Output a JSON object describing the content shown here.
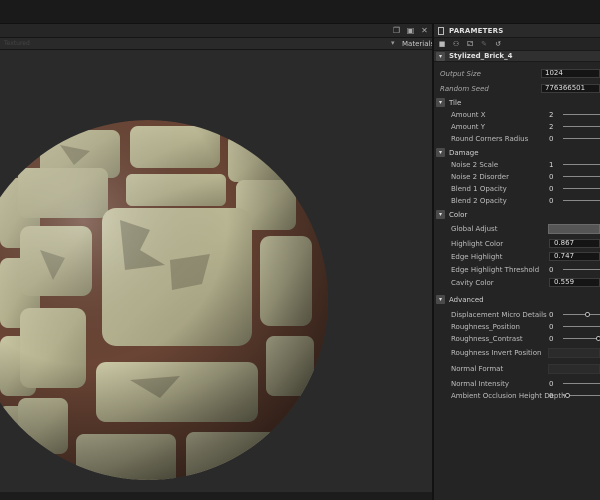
{
  "viewport": {
    "toolbar_ghost": "Textured",
    "materials_label": "Materials"
  },
  "panel": {
    "title": "PARAMETERS",
    "graph_name": "Stylized_Brick_4",
    "toggle_symbol": "▾",
    "collapse_symbol": "▾",
    "tools": [
      "lock-icon",
      "presets-icon",
      "random-icon",
      "pin-icon",
      "reset-icon"
    ],
    "output_size": {
      "label": "Output Size",
      "value": "1024"
    },
    "random_seed": {
      "label": "Random Seed",
      "value": "776366501"
    },
    "sections": {
      "tile": "Tile",
      "damage": "Damage",
      "color": "Color",
      "advanced": "Advanced"
    },
    "tile": [
      {
        "label": "Amount X",
        "value": "2",
        "level": 0.5
      },
      {
        "label": "Amount Y",
        "value": "2",
        "level": 0.5
      },
      {
        "label": "Round Corners Radius",
        "value": "0",
        "level": 0
      }
    ],
    "damage": [
      {
        "label": "Noise 2 Scale",
        "value": "1",
        "level": 0.5
      },
      {
        "label": "Noise 2 Disorder",
        "value": "0",
        "level": 0
      },
      {
        "label": "Blend 1 Opacity",
        "value": "0",
        "level": 0
      },
      {
        "label": "Blend 2 Opacity",
        "value": "0",
        "level": 0
      }
    ],
    "color": {
      "global_adjust": "Global Adjust",
      "global_adjust_color": "#555555",
      "highlight_color": {
        "label": "Highlight Color",
        "value": "0.867"
      },
      "edge_highlight": {
        "label": "Edge Highlight",
        "value": "0.747"
      },
      "edge_threshold": {
        "label": "Edge Highlight Threshold",
        "value": "0",
        "level": 0
      },
      "cavity_color": {
        "label": "Cavity Color",
        "value": "0.559"
      }
    },
    "advanced": {
      "micro_details": {
        "label": "Displacement Micro Details",
        "value": "0",
        "level": 0.75
      },
      "roughness_position": {
        "label": "Roughness_Position",
        "value": "0",
        "level": 0.5
      },
      "roughness_contrast": {
        "label": "Roughness_Contrast",
        "value": "0",
        "level": 1.0
      },
      "roughness_invert": {
        "label": "Roughness Invert Position"
      },
      "normal_format": {
        "label": "Normal Format"
      },
      "normal_intensity": {
        "label": "Normal Intensity",
        "value": "0",
        "level": 0.5
      },
      "ao_depth": {
        "label": "Ambient Occlusion Height Depth",
        "value": "0",
        "level": 0.05
      }
    }
  },
  "colors": {
    "brick_stone": "#b7b491",
    "brick_shadow": "#6d6a55",
    "mortar": "#6a4535",
    "viewport_bg": "#2a2a2a"
  }
}
